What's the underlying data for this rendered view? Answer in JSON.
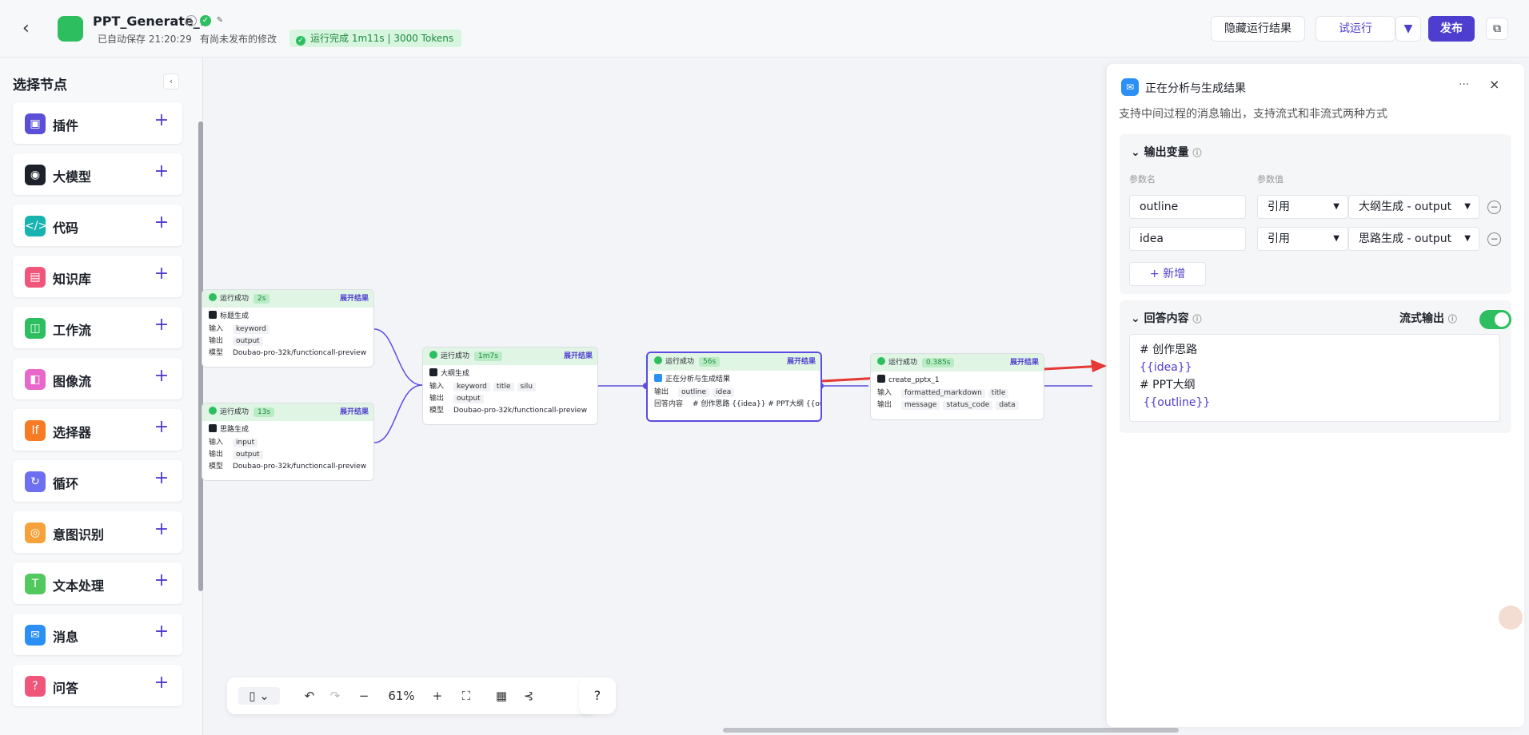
{
  "header": {
    "back_icon": "chevron-left-icon",
    "title": "PPT_Generate_1",
    "autosave": "已自动保存 21:20:29",
    "unpublished": "有尚未发布的修改",
    "run_status": "运行完成 1m11s | 3000 Tokens",
    "hide_results": "隐藏运行结果",
    "test_run": "试运行",
    "publish": "发布"
  },
  "sidebar": {
    "title": "选择节点",
    "items": [
      {
        "label": "插件",
        "icon": "plugin-icon",
        "color": "#5b4fd8"
      },
      {
        "label": "大模型",
        "icon": "llm-icon",
        "color": "#1d2129"
      },
      {
        "label": "代码",
        "icon": "code-icon",
        "color": "#16b3b0"
      },
      {
        "label": "知识库",
        "icon": "knowledge-icon",
        "color": "#f0567a"
      },
      {
        "label": "工作流",
        "icon": "workflow-icon",
        "color": "#2dbe60"
      },
      {
        "label": "图像流",
        "icon": "imageflow-icon",
        "color": "#e868c9"
      },
      {
        "label": "选择器",
        "icon": "selector-icon",
        "color": "#f77b22"
      },
      {
        "label": "循环",
        "icon": "loop-icon",
        "color": "#6b6ff0"
      },
      {
        "label": "意图识别",
        "icon": "intent-icon",
        "color": "#f6a23a"
      },
      {
        "label": "文本处理",
        "icon": "text-icon",
        "color": "#52c95e"
      },
      {
        "label": "消息",
        "icon": "message-icon",
        "color": "#2b8ff5"
      },
      {
        "label": "问答",
        "icon": "qa-icon",
        "color": "#f0567a"
      }
    ]
  },
  "nodes": {
    "success": "运行成功",
    "expand": "展开结果",
    "in": "输入",
    "out": "输出",
    "model": "模型",
    "answer": "回答内容",
    "title_node": {
      "time": "2s",
      "name": "标题生成",
      "input": "keyword",
      "output": "output",
      "model": "Doubao-pro-32k/functioncall-preview"
    },
    "idea_node": {
      "time": "13s",
      "name": "思路生成",
      "input": "input",
      "output": "output",
      "model": "Doubao-pro-32k/functioncall-preview"
    },
    "outline_node": {
      "time": "1m7s",
      "name": "大纲生成",
      "inputs": [
        "keyword",
        "title",
        "silu"
      ],
      "output": "output",
      "model": "Doubao-pro-32k/functioncall-preview"
    },
    "msg_node": {
      "time": "56s",
      "name": "正在分析与生成结果",
      "outputs": [
        "outline",
        "idea"
      ],
      "answer": "# 创作思路 {{idea}} # PPT大纲 {{outli..."
    },
    "pptx_node": {
      "time": "0.385s",
      "name": "create_pptx_1",
      "inputs": [
        "formatted_markdown",
        "title"
      ],
      "outputs": [
        "message",
        "status_code",
        "data"
      ]
    }
  },
  "toolbar": {
    "zoom": "61%"
  },
  "panel": {
    "title": "正在分析与生成结果",
    "desc": "支持中间过程的消息输出，支持流式和非流式两种方式",
    "out_vars": "输出变量",
    "param_name": "参数名",
    "param_value": "参数值",
    "rows": [
      {
        "name": "outline",
        "type": "引用",
        "value": "大纲生成 - output"
      },
      {
        "name": "idea",
        "type": "引用",
        "value": "思路生成 - output"
      }
    ],
    "add": "新增",
    "answer_title": "回答内容",
    "stream": "流式输出",
    "answer_lines": [
      "# 创作思路",
      "{{idea}}",
      "# PPT大纲",
      " {{outline}}"
    ]
  }
}
